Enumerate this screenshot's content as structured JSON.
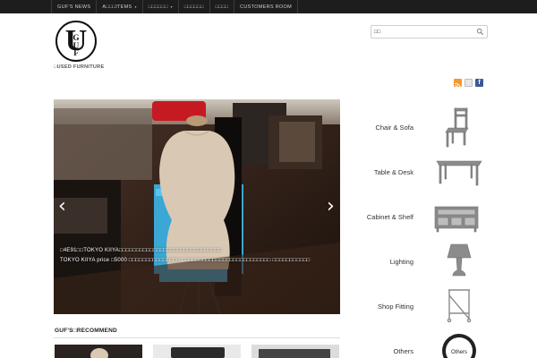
{
  "nav": {
    "items": [
      {
        "label": "GUF'S NEWS",
        "has_caret": false
      },
      {
        "label": "A□□□ITEMS",
        "has_caret": true
      },
      {
        "label": "□□□□□□",
        "has_caret": true
      },
      {
        "label": "□□□□□□",
        "has_caret": false
      },
      {
        "label": "□□□□",
        "has_caret": false
      },
      {
        "label": "CUSTOMERS ROOM",
        "has_caret": false
      }
    ],
    "caret": "▾"
  },
  "logo": {
    "letter": "U",
    "letters_small": "G\nU\nF"
  },
  "tagline": "□USED FURNITURE",
  "search": {
    "value": "□□",
    "placeholder": ""
  },
  "social": {
    "rss_icon": "rss-icon",
    "delicious_icon": "delicious-icon",
    "facebook_icon": "facebook-icon",
    "facebook_letter": "f"
  },
  "slider": {
    "prev": "‹",
    "next": "›",
    "caption_line1": "□4E91□□TOKYO KIIYA□□□□□□□□□□□□□□□□□□□□□□□□□□□□□□",
    "caption_line2": "TOKYO KIIYA price □5000 □□□□□□□□□□□□□□□ □□□□□□□□□□□□□□□□□□□□□□□□□□ □□□□□□□□□□□"
  },
  "recommend": {
    "title": "GUF'S□RECOMMEND"
  },
  "categories": [
    {
      "label": "Chair & Sofa",
      "icon": "chair-icon"
    },
    {
      "label": "Table & Desk",
      "icon": "table-icon"
    },
    {
      "label": "Cabinet & Shelf",
      "icon": "cabinet-icon"
    },
    {
      "label": "Lighting",
      "icon": "lamp-icon"
    },
    {
      "label": "Shop Fitting",
      "icon": "rack-icon"
    },
    {
      "label": "Others",
      "icon": "others-icon",
      "badge": "Others"
    }
  ],
  "colors": {
    "topnav_bg": "#1d1d1d",
    "rss": "#f29a2e",
    "facebook": "#3b5998",
    "icon_gray": "#8c8c8c"
  }
}
